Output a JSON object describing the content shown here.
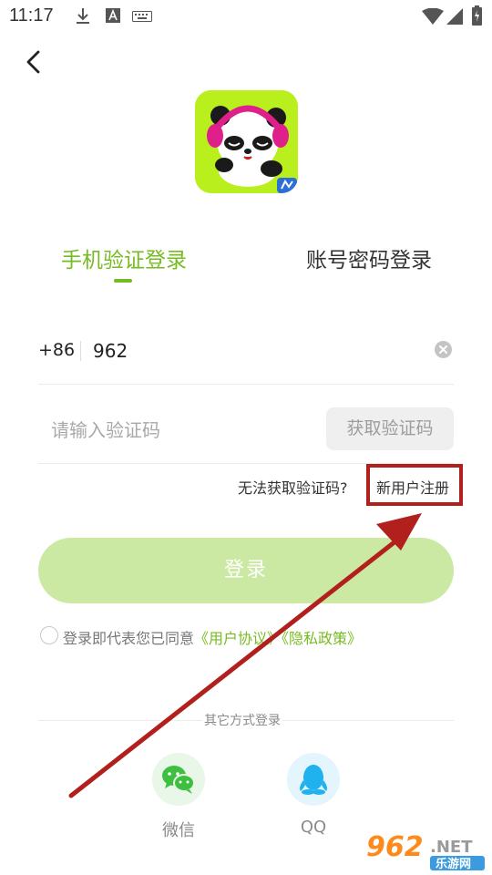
{
  "status_bar": {
    "time": "11:17"
  },
  "tabs": {
    "active": "手机验证登录",
    "inactive": "账号密码登录"
  },
  "phone": {
    "country_code": "+86",
    "value": "962"
  },
  "code": {
    "placeholder": "请输入验证码",
    "get_code": "获取验证码"
  },
  "links": {
    "cannot_get_code": "无法获取验证码?",
    "register": "新用户注册"
  },
  "login": {
    "label": "登录"
  },
  "agreement": {
    "prefix": "登录即代表您已同意",
    "user_agreement": "《用户协议》",
    "privacy_policy": "《隐私政策》"
  },
  "other_login": {
    "label": "其它方式登录",
    "options": [
      {
        "label": "微信",
        "icon": "wechat-icon"
      },
      {
        "label": "QQ",
        "icon": "qq-icon"
      }
    ]
  },
  "watermark": {
    "number": "962",
    "suffix": ".NET",
    "site": "乐游网"
  },
  "colors": {
    "accent": "#77bb22",
    "login_button": "#cbe9a2",
    "highlight": "#b1201c",
    "wechat": "#3fbf3f",
    "qq": "#20b2ee"
  }
}
